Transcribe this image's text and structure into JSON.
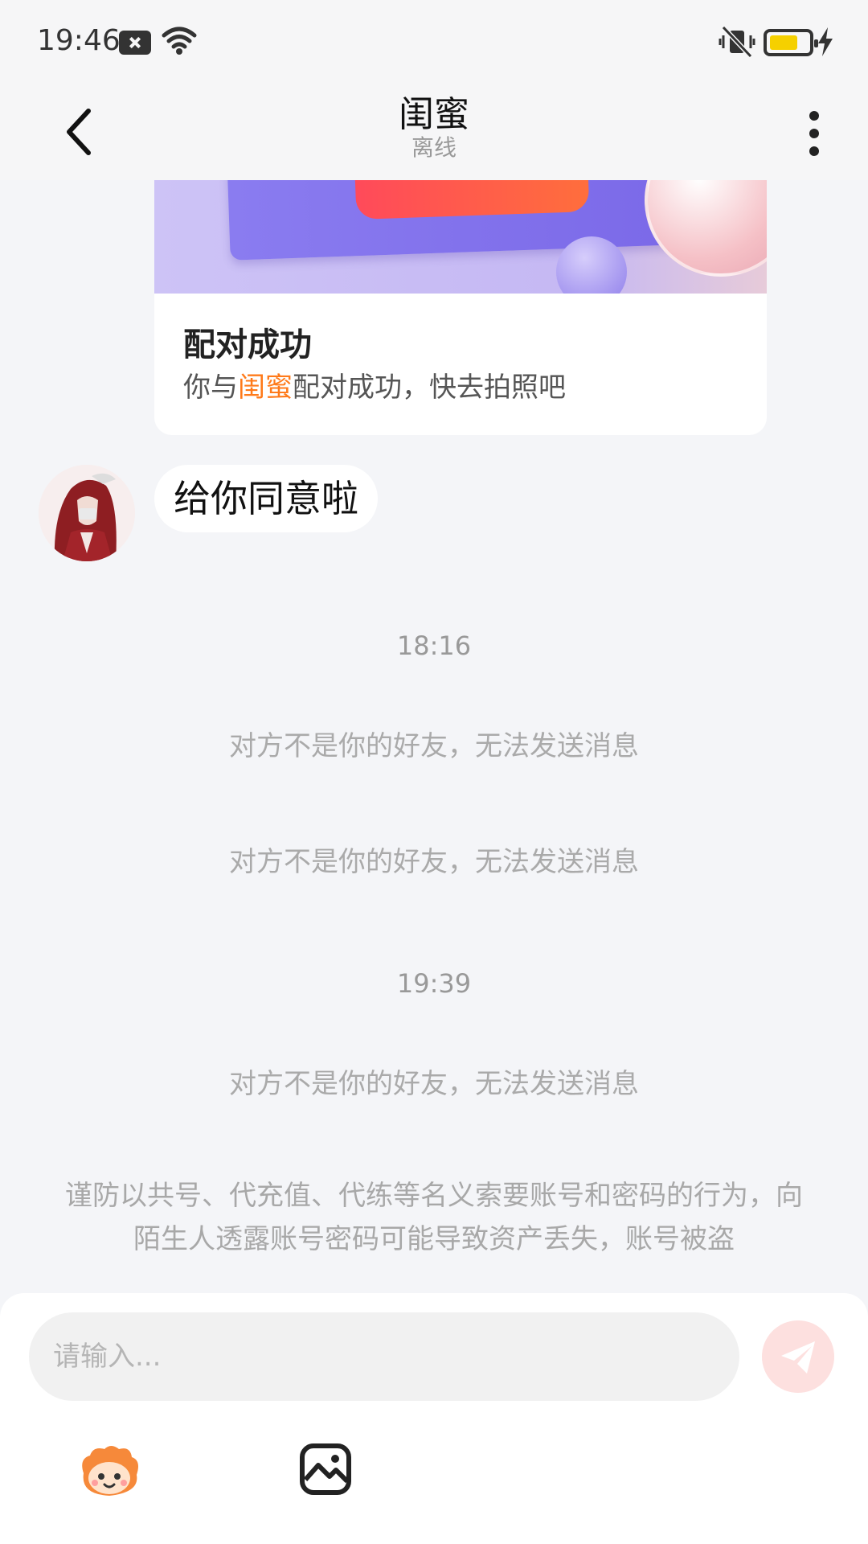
{
  "status_bar": {
    "time": "19:46",
    "icons": [
      "notification-box-icon",
      "wifi-icon",
      "vibrate-off-icon",
      "battery-icon",
      "charging-icon"
    ],
    "battery_color": "#f5d000"
  },
  "header": {
    "title": "闺蜜",
    "subtitle": "离线",
    "back_icon": "chevron-left-icon",
    "more_icon": "more-vertical-icon"
  },
  "pair_card": {
    "title": "配对成功",
    "desc_prefix": "你与",
    "desc_name": "闺蜜",
    "desc_suffix": "配对成功，快去拍照吧",
    "highlight_color": "#ff7a1a"
  },
  "messages": [
    {
      "type": "received",
      "text": "给你同意啦"
    }
  ],
  "timeline": [
    {
      "time": "18:16"
    },
    {
      "notice": "对方不是你的好友，无法发送消息"
    },
    {
      "notice": "对方不是你的好友，无法发送消息"
    },
    {
      "time": "19:39"
    },
    {
      "notice": "对方不是你的好友，无法发送消息"
    }
  ],
  "warning": "谨防以共号、代充值、代练等名义索要账号和密码的行为，向陌生人透露账号密码可能导致资产丢失，账号被盗",
  "input_bar": {
    "placeholder": "请输入...",
    "value": "",
    "send_icon": "paper-plane-icon",
    "tool_icons": [
      "mascot-sticker-icon",
      "image-icon"
    ]
  }
}
